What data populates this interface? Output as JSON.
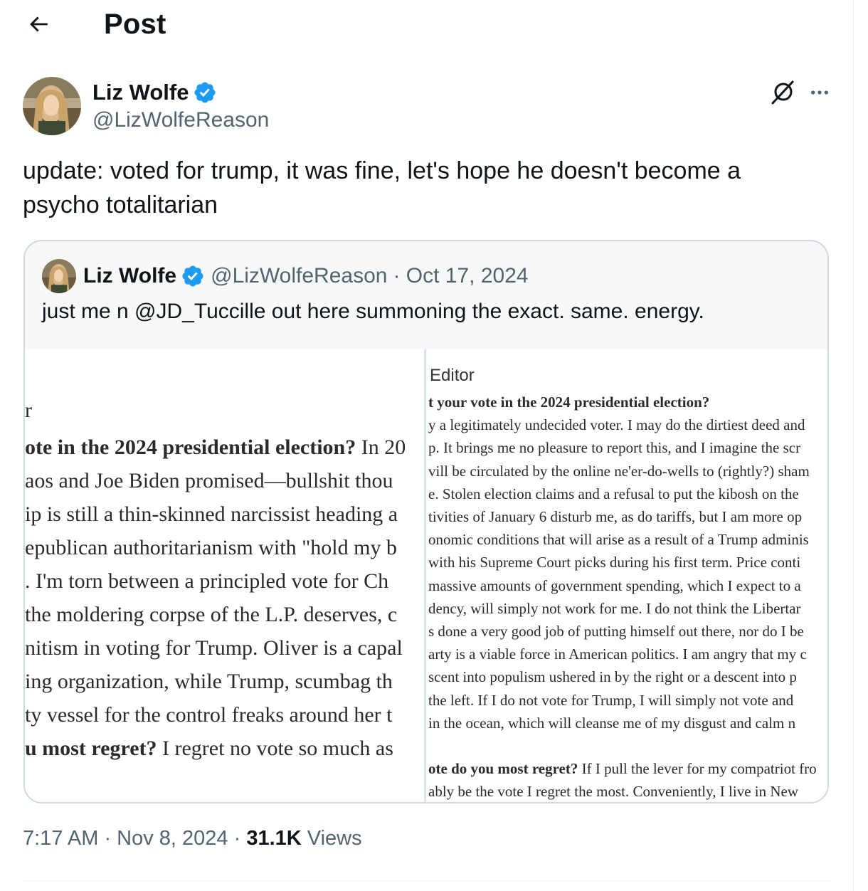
{
  "header": {
    "title": "Post",
    "back_icon": "arrow-left-icon"
  },
  "post": {
    "author_name": "Liz Wolfe",
    "author_handle": "@LizWolfeReason",
    "verified_color": "#1d9bf0",
    "text": "update: voted for trump, it was fine, let's hope he doesn't become a psycho totalitarian",
    "timestamp": "7:17 AM · Nov 8, 2024",
    "views_sep": " · ",
    "views_count": "31.1K",
    "views_label": " Views"
  },
  "quote": {
    "author_name": "Liz Wolfe",
    "author_handle": "@LizWolfeReason",
    "date": "· Oct 17, 2024",
    "text": "just me n @JD_Tuccille out here summoning the exact. same. energy.",
    "image_left_lines": [
      {
        "bold": "",
        "text": "r"
      },
      {
        "bold": "ote in the 2024 presidential election?",
        "text": " In 20"
      },
      {
        "bold": "",
        "text": "aos and Joe Biden promised—bullshit thou"
      },
      {
        "bold": "",
        "text": "ip is still a thin-skinned narcissist heading a"
      },
      {
        "bold": "",
        "text": "epublican authoritarianism with \"hold my b"
      },
      {
        "bold": "",
        "text": ". I'm torn between a principled vote for Ch"
      },
      {
        "bold": "",
        "text": "the moldering corpse of the L.P. deserves, c"
      },
      {
        "bold": "",
        "text": "nitism in voting for Trump. Oliver is a capal"
      },
      {
        "bold": "",
        "text": "ing organization, while Trump, scumbag th"
      },
      {
        "bold": "",
        "text": "ty vessel for the control freaks around her t"
      },
      {
        "bold": "u most regret?",
        "text": " I regret no vote so much as"
      }
    ],
    "image_right_header": "Editor",
    "image_right_lines": [
      {
        "bold": "t your vote in the 2024 presidential election?",
        "text": ""
      },
      {
        "bold": "",
        "text": "y a legitimately undecided voter. I may do the dirtiest deed and"
      },
      {
        "bold": "",
        "text": "p. It brings me no pleasure to report this, and I imagine the scr"
      },
      {
        "bold": "",
        "text": "vill be circulated by the online ne'er-do-wells to (rightly?) sham"
      },
      {
        "bold": "",
        "text": "e. Stolen election claims and a refusal to put the kibosh on the"
      },
      {
        "bold": "",
        "text": "tivities of January 6 disturb me, as do tariffs, but I am more op"
      },
      {
        "bold": "",
        "text": "onomic conditions that will arise as a result of a Trump adminis"
      },
      {
        "bold": "",
        "text": "with his Supreme Court picks during his first term. Price conti"
      },
      {
        "bold": "",
        "text": "massive amounts of government spending, which I expect to a"
      },
      {
        "bold": "",
        "text": "dency, will simply not work for me. I do not think the Libertar"
      },
      {
        "bold": "",
        "text": "s done a very good job of putting himself out there, nor do I be"
      },
      {
        "bold": "",
        "text": "arty is a viable force in American politics. I am angry that my c"
      },
      {
        "bold": "",
        "text": "scent into populism ushered in by the right or a descent into p"
      },
      {
        "bold": "",
        "text": "the left. If I do not vote for Trump, I will simply not vote and"
      },
      {
        "bold": "",
        "text": "in the ocean, which will cleanse me of my disgust and calm n"
      },
      {
        "bold": "",
        "text": ""
      },
      {
        "bold": "ote do you most regret?",
        "text": " If I pull the lever for my compatriot fro"
      },
      {
        "bold": "",
        "text": "ably be the vote I regret the most. Conveniently, I live in New"
      }
    ]
  },
  "icons": {
    "back": "arrow-left-icon",
    "verified": "verified-badge-icon",
    "grok": "grok-icon",
    "more": "more-horizontal-icon"
  }
}
